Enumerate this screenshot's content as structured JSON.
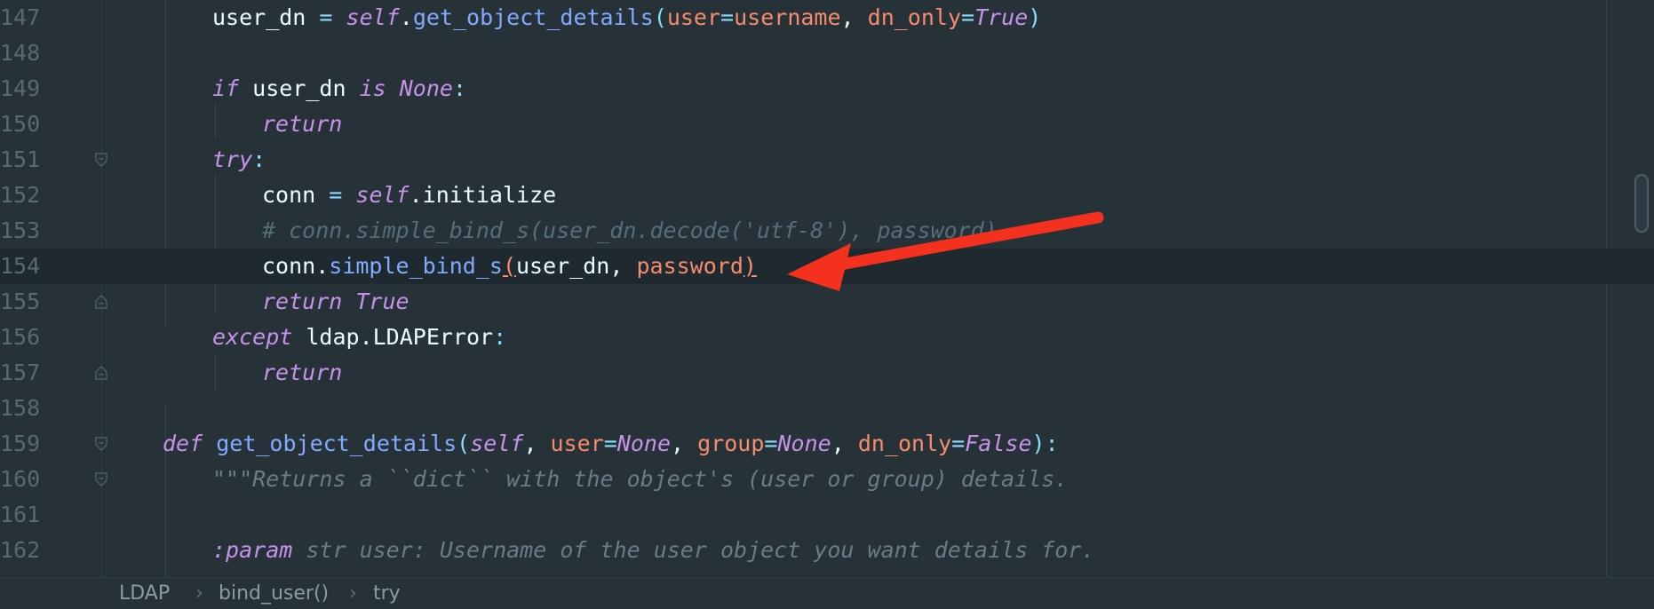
{
  "code_lines": [
    {
      "num": "147",
      "indent": 2,
      "tokens": [
        [
          "user_dn ",
          ""
        ],
        [
          "=",
          "op"
        ],
        [
          " ",
          ""
        ],
        [
          "self",
          "kw"
        ],
        [
          ".",
          ""
        ],
        [
          "get_object_details",
          "fn"
        ],
        [
          "(",
          "op"
        ],
        [
          "user",
          "param"
        ],
        [
          "=",
          "op"
        ],
        [
          "username",
          "param"
        ],
        [
          ", ",
          ""
        ],
        [
          "dn_only",
          "param"
        ],
        [
          "=",
          "op"
        ],
        [
          "True",
          "kw"
        ],
        [
          ")",
          "op"
        ]
      ]
    },
    {
      "num": "148",
      "indent": 0,
      "tokens": []
    },
    {
      "num": "149",
      "indent": 2,
      "tokens": [
        [
          "if",
          "kw"
        ],
        [
          " user_dn ",
          ""
        ],
        [
          "is",
          "kw"
        ],
        [
          " ",
          ""
        ],
        [
          "None",
          "kw"
        ],
        [
          ":",
          "op"
        ]
      ]
    },
    {
      "num": "150",
      "indent": 3,
      "tokens": [
        [
          "return",
          "kw"
        ]
      ]
    },
    {
      "num": "151",
      "indent": 2,
      "tokens": [
        [
          "try",
          "kw"
        ],
        [
          ":",
          "op"
        ]
      ]
    },
    {
      "num": "152",
      "indent": 3,
      "tokens": [
        [
          "conn ",
          ""
        ],
        [
          "=",
          "op"
        ],
        [
          " ",
          ""
        ],
        [
          "self",
          "kw"
        ],
        [
          ".initialize",
          ""
        ]
      ]
    },
    {
      "num": "153",
      "indent": 3,
      "tokens": [
        [
          "# conn.simple_bind_s(user_dn.decode('utf-8'), password)",
          "cm"
        ]
      ]
    },
    {
      "num": "154",
      "indent": 3,
      "tokens": [
        [
          "conn.",
          ""
        ],
        [
          "simple_bind_s",
          "fn"
        ],
        [
          "(",
          "param ul"
        ],
        [
          "user_dn, ",
          ""
        ],
        [
          "password",
          "param"
        ],
        [
          ")",
          "param ul"
        ]
      ]
    },
    {
      "num": "155",
      "indent": 3,
      "tokens": [
        [
          "return",
          "kw"
        ],
        [
          " ",
          ""
        ],
        [
          "True",
          "kw"
        ]
      ]
    },
    {
      "num": "156",
      "indent": 2,
      "tokens": [
        [
          "except",
          "kw"
        ],
        [
          " ldap.LDAPError",
          ""
        ],
        [
          ":",
          "op"
        ]
      ]
    },
    {
      "num": "157",
      "indent": 3,
      "tokens": [
        [
          "return",
          "kw"
        ]
      ]
    },
    {
      "num": "158",
      "indent": 0,
      "tokens": []
    },
    {
      "num": "159",
      "indent": 1,
      "tokens": [
        [
          "def",
          "kw"
        ],
        [
          " ",
          ""
        ],
        [
          "get_object_details",
          "fn"
        ],
        [
          "(",
          "op"
        ],
        [
          "self",
          "kw"
        ],
        [
          ", ",
          ""
        ],
        [
          "user",
          "param"
        ],
        [
          "=",
          "op"
        ],
        [
          "None",
          "kw"
        ],
        [
          ", ",
          ""
        ],
        [
          "group",
          "param"
        ],
        [
          "=",
          "op"
        ],
        [
          "None",
          "kw"
        ],
        [
          ", ",
          ""
        ],
        [
          "dn_only",
          "param"
        ],
        [
          "=",
          "op"
        ],
        [
          "False",
          "kw"
        ],
        [
          ")",
          "op"
        ],
        [
          ":",
          "op"
        ]
      ]
    },
    {
      "num": "160",
      "indent": 2,
      "tokens": [
        [
          "\"\"\"Returns a ``dict`` with the object's (user or group) details.",
          "doc"
        ]
      ]
    },
    {
      "num": "161",
      "indent": 0,
      "tokens": []
    },
    {
      "num": "162",
      "indent": 2,
      "tokens": [
        [
          ":param",
          "doctag"
        ],
        [
          " str user: Username of the user object you want details for.",
          "doc"
        ]
      ]
    }
  ],
  "current_line": "154",
  "fold_markers": {
    "151": "open",
    "155": "close",
    "157": "close",
    "159": "open",
    "160": "open"
  },
  "breadcrumb": [
    "LDAP",
    "bind_user()",
    "try"
  ],
  "icons": {
    "fold_open": "fold-open-icon",
    "fold_close": "fold-close-icon",
    "breadcrumb_separator": "chevron-right-icon"
  },
  "colors": {
    "background": "#263238",
    "keyword": "#C792EA",
    "function": "#82AAFF",
    "parameter": "#F78C6C",
    "operator": "#89DDFF",
    "comment": "#546E7A",
    "annotation_arrow": "#F4311F"
  }
}
